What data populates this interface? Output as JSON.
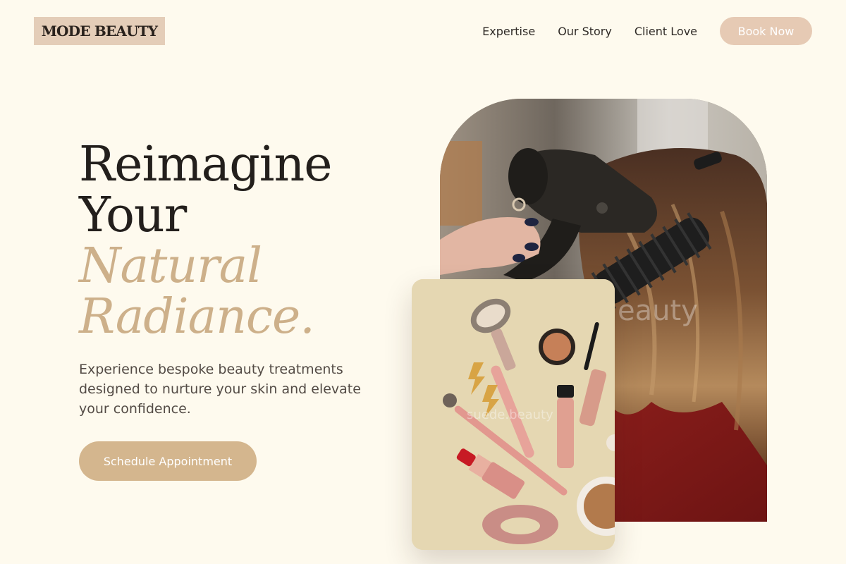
{
  "brand": {
    "logo_text": "MODE BEAUTY"
  },
  "nav": {
    "links": [
      "Expertise",
      "Our Story",
      "Client Love"
    ],
    "book_label": "Book Now"
  },
  "hero": {
    "title_lines": [
      "Reimagine",
      "Your"
    ],
    "accent_lines": [
      "Natural",
      "Radiance."
    ],
    "subtitle": "Experience bespoke beauty treatments designed to nurture your skin and elevate your confidence.",
    "cta_label": "Schedule Appointment"
  },
  "images": {
    "hair_watermark": "eauty",
    "makeup_watermark": "suede.beauty"
  },
  "colors": {
    "background": "#FEFAEE",
    "logo_bg": "#E4CDB8",
    "book_button": "#E6CAB4",
    "accent": "#CDB08A",
    "cta_button": "#D4B68E",
    "text_dark": "#231F1C"
  }
}
